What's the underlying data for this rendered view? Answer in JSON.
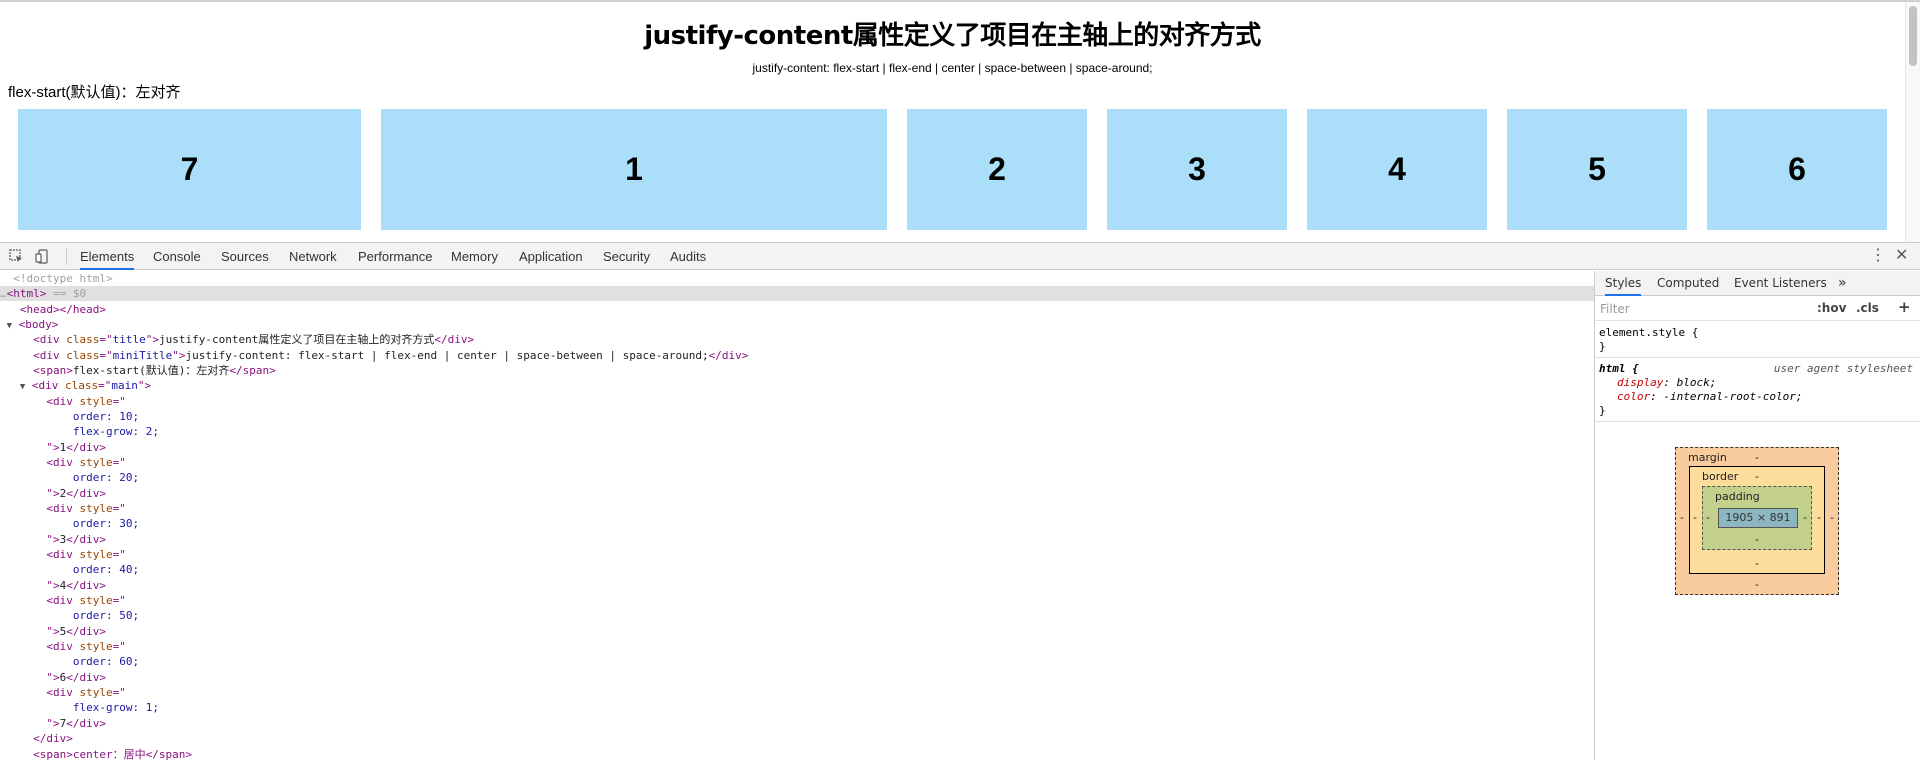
{
  "page": {
    "title": "justify-content属性定义了项目在主轴上的对齐方式",
    "mini_title": "justify-content: flex-start | flex-end | center | space-between | space-around;",
    "section_label": "flex-start(默认值)：左对齐",
    "boxes": [
      "7",
      "1",
      "2",
      "3",
      "4",
      "5",
      "6"
    ]
  },
  "devtools": {
    "tabs": [
      "Elements",
      "Console",
      "Sources",
      "Network",
      "Performance",
      "Memory",
      "Application",
      "Security",
      "Audits"
    ],
    "active_tab": "Elements",
    "dom": {
      "doctype": "<!doctype html>",
      "html_open": "<html>",
      "html_ref": " == $0",
      "head": "<head></head>",
      "body_open": "<body>",
      "title_div_class": "title",
      "title_div_text": "justify-content属性定义了项目在主轴上的对齐方式",
      "mini_div_class": "miniTitle",
      "mini_div_text": "justify-content: flex-start | flex-end | center | space-between | space-around;",
      "span_text": "flex-start(默认值)：左对齐",
      "main_class": "main",
      "items": [
        {
          "styles": [
            "order: 10;",
            "flex-grow: 2;"
          ],
          "label": "1"
        },
        {
          "styles": [
            "order: 20;"
          ],
          "label": "2"
        },
        {
          "styles": [
            "order: 30;"
          ],
          "label": "3"
        },
        {
          "styles": [
            "order: 40;"
          ],
          "label": "4"
        },
        {
          "styles": [
            "order: 50;"
          ],
          "label": "5"
        },
        {
          "styles": [
            "order: 60;"
          ],
          "label": "6"
        },
        {
          "styles": [
            "flex-grow: 1;"
          ],
          "label": "7"
        }
      ],
      "main_close": "</div>",
      "cut_line": "<span>center：居中</span>"
    },
    "styles_pane": {
      "tabs": [
        "Styles",
        "Computed",
        "Event Listeners"
      ],
      "more": "»",
      "filter_placeholder": "Filter",
      "hov": ":hov",
      "cls": ".cls",
      "plus": "+",
      "element_style": "element.style {",
      "close_brace": "}",
      "html_selector": "html {",
      "ua_label": "user agent stylesheet",
      "prop1_name": "display",
      "prop1_value": "block;",
      "prop2_name": "color",
      "prop2_value": "-internal-root-color;",
      "box_model": {
        "margin_label": "margin",
        "border_label": "border",
        "padding_label": "padding",
        "content_size": "1905 × 891",
        "dash": "-"
      }
    }
  }
}
